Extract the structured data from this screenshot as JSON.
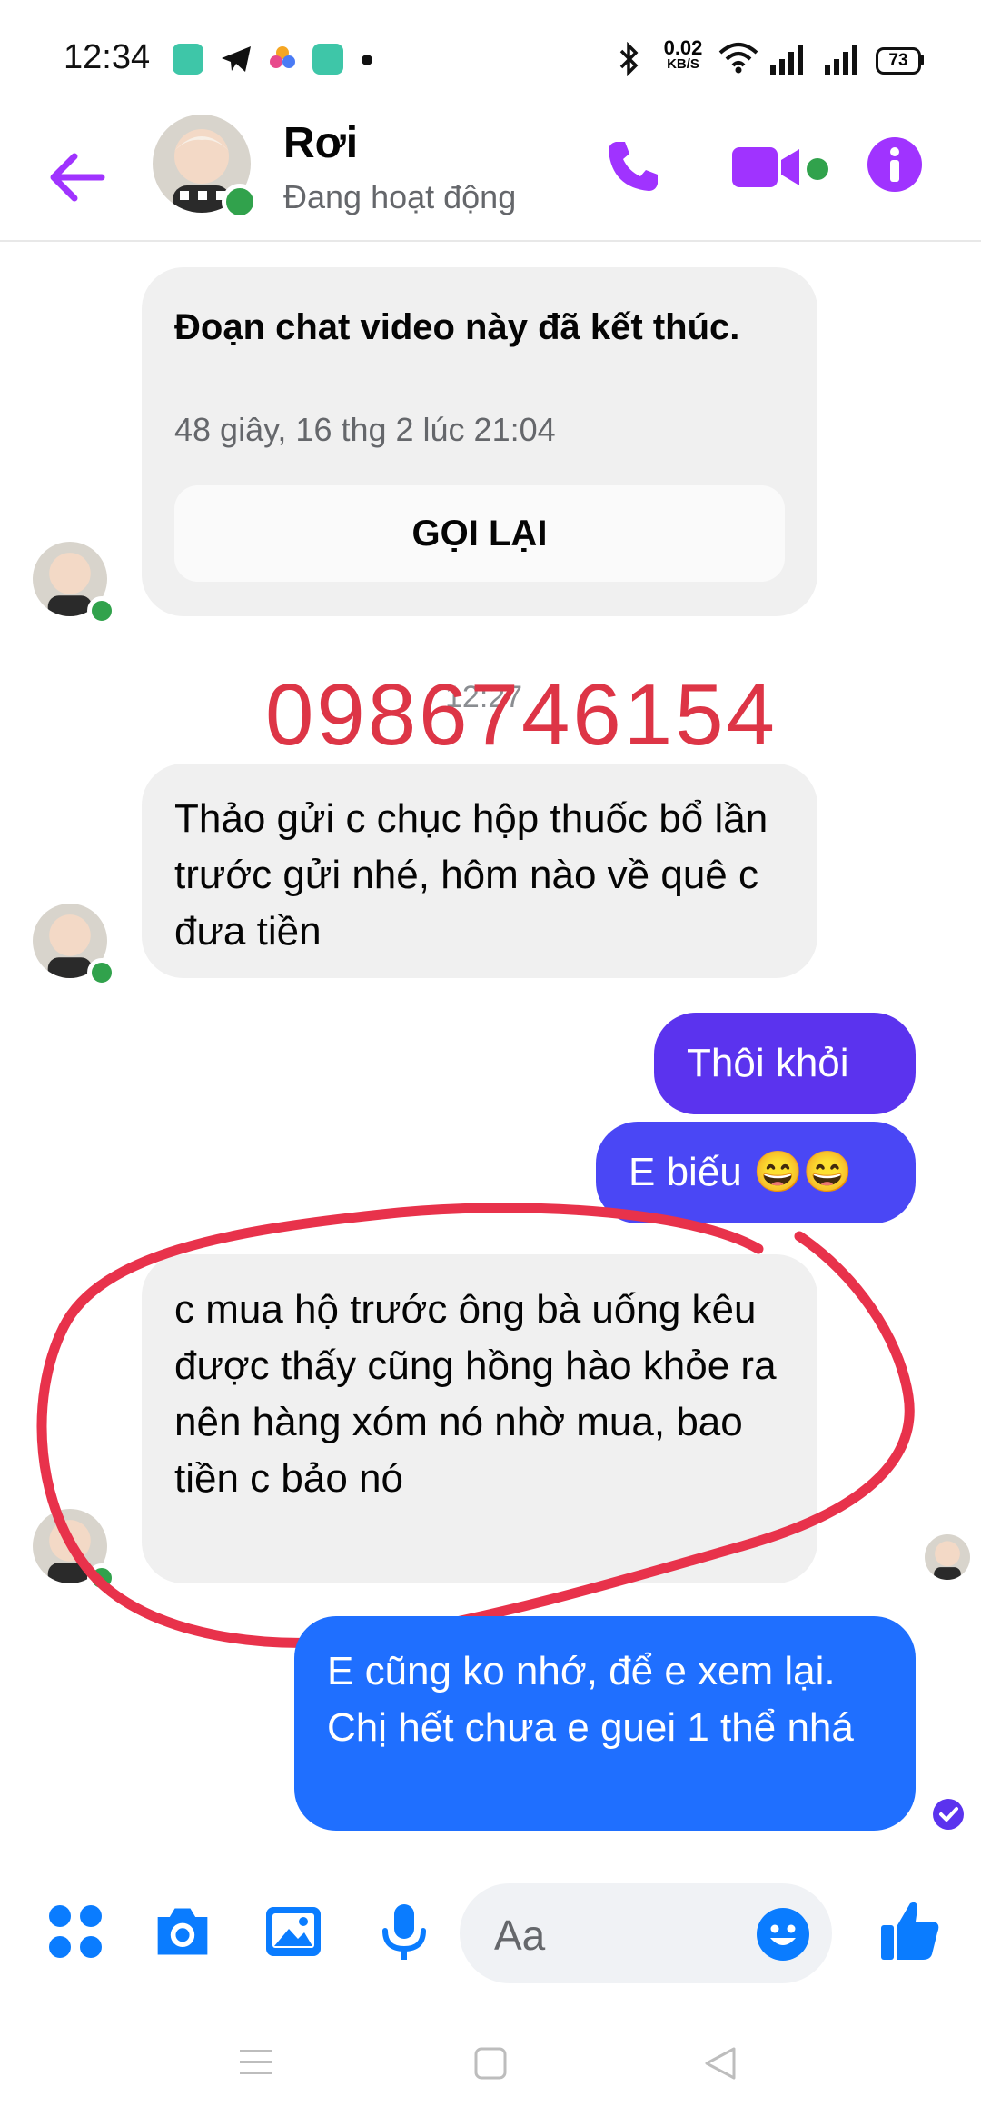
{
  "status_bar": {
    "time": "12:34",
    "net_speed_value": "0.02",
    "net_speed_unit": "KB/S",
    "battery": "73"
  },
  "header": {
    "contact_name": "Rơi",
    "contact_status": "Đang hoạt động"
  },
  "call_card": {
    "title": "Đoạn chat video này đã kết thúc.",
    "meta": "48 giây, 16 thg 2 lúc 21:04",
    "button_label": "GỌI LẠI"
  },
  "overlay_text": "0986746154",
  "timestamp": "12:27",
  "messages": [
    {
      "direction": "in",
      "text": "Thảo gửi c chục hộp thuốc bổ lần trước gửi nhé, hôm nào về quê c đưa tiền"
    },
    {
      "direction": "out",
      "text": "Thôi khỏi"
    },
    {
      "direction": "out",
      "text": "E biếu 😄😄"
    },
    {
      "direction": "in",
      "text": "c mua hộ trước ông bà uống kêu được thấy cũng hồng hào khỏe ra nên hàng xóm nó nhờ mua, bao tiền c bảo nó"
    },
    {
      "direction": "out",
      "text": "E cũng ko nhớ, để e xem lại. Chị hết chưa e guei 1 thể nhá"
    }
  ],
  "composer": {
    "placeholder": "Aa"
  },
  "colors": {
    "accent_purple": "#a033ff",
    "bubble_out_start": "#5b2dff",
    "bubble_out_end": "#1f6fff",
    "bubble_in": "#f0f0f0",
    "online_green": "#31a24c",
    "annotation_red": "#e8324b",
    "composer_blue": "#0a7cff"
  },
  "icons": [
    "back-arrow-icon",
    "phone-icon",
    "video-camera-icon",
    "info-icon",
    "apps-icon",
    "camera-icon",
    "image-icon",
    "microphone-icon",
    "emoji-icon",
    "thumbs-up-icon",
    "seen-check-icon",
    "menu-nav-icon",
    "home-nav-icon",
    "back-nav-icon"
  ]
}
